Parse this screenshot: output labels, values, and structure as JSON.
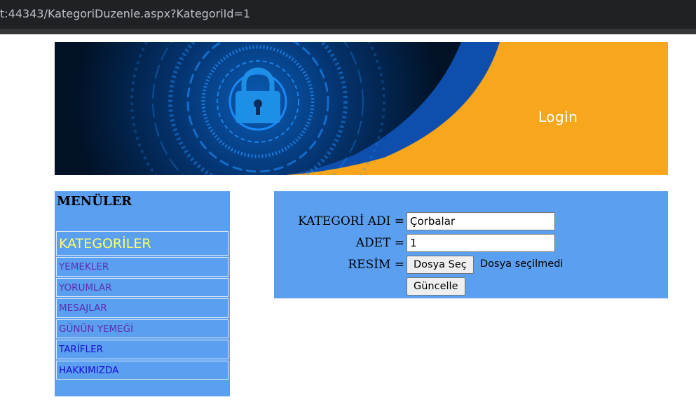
{
  "browser": {
    "url": "t:44343/KategoriDuzenle.aspx?KategoriId=1"
  },
  "banner": {
    "login_label": "Login",
    "colors": {
      "dark": "#021426",
      "blue": "#0d4fae",
      "orange": "#f8a61b",
      "glow": "#1e90ff"
    },
    "icon": "padlock-icon"
  },
  "menu": {
    "title": "MENÜLER",
    "items": [
      {
        "label": "KATEGORİLER"
      },
      {
        "label": "YEMEKLER"
      },
      {
        "label": "YORUMLAR"
      },
      {
        "label": "MESAJLAR"
      },
      {
        "label": "GÜNÜN YEMEĞİ"
      },
      {
        "label": "TARİFLER"
      },
      {
        "label": "HAKKIMIZDA"
      }
    ]
  },
  "form": {
    "name_label": "KATEGORİ ADI =",
    "name_value": "Çorbalar",
    "count_label": "ADET =",
    "count_value": "1",
    "image_label": "RESİM =",
    "file_button": "Dosya Seç",
    "file_status": "Dosya seçilmedi",
    "submit_label": "Güncelle"
  },
  "colors": {
    "panel_bg": "#5b9ff0",
    "active_item": "#ffff66",
    "link": "#5a2fb0",
    "link_alt": "#1a0dd8"
  }
}
